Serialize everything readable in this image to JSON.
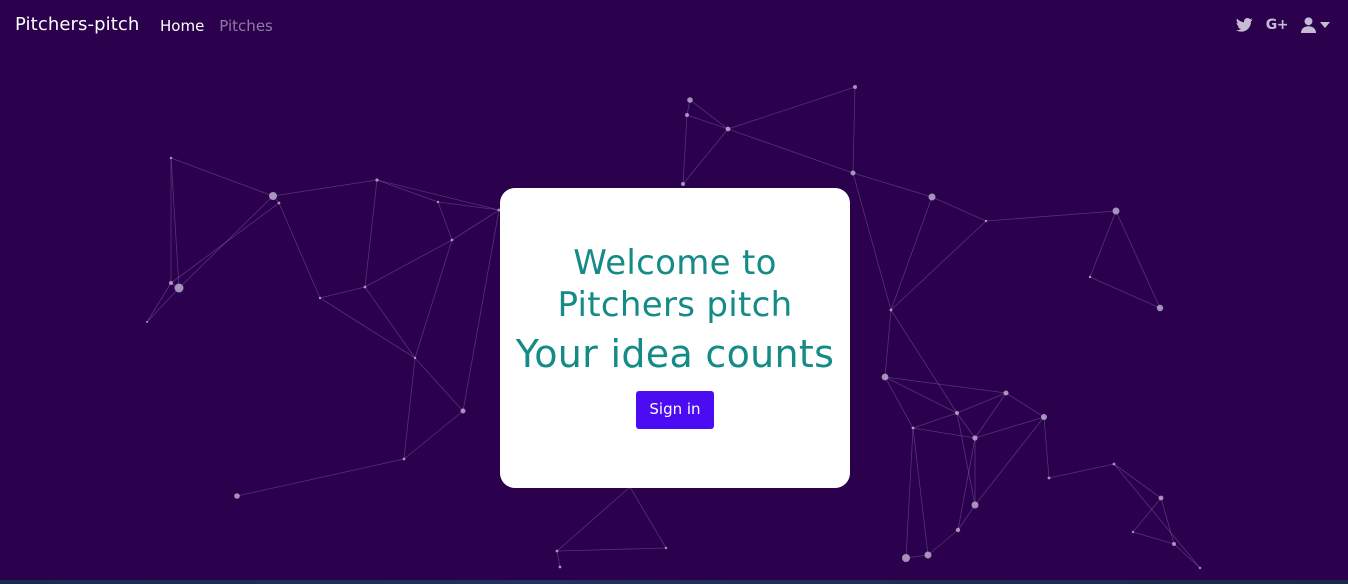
{
  "navbar": {
    "brand": "Pitchers-pitch",
    "links": [
      {
        "label": "Home"
      },
      {
        "label": "Pitches"
      }
    ],
    "icons": [
      "twitter-icon",
      "google-plus-icon",
      "user-icon",
      "caret-down-icon"
    ],
    "google_plus_text": "G+"
  },
  "hero": {
    "welcome": "Welcome to Pitchers pitch",
    "tagline": "Your idea counts",
    "signin_label": "Sign in"
  },
  "colors": {
    "background": "#2b004d",
    "heading": "#148b86",
    "button": "#4b0bf3",
    "nav_muted": "#8f7aa8",
    "icon": "#c6bbd5"
  }
}
